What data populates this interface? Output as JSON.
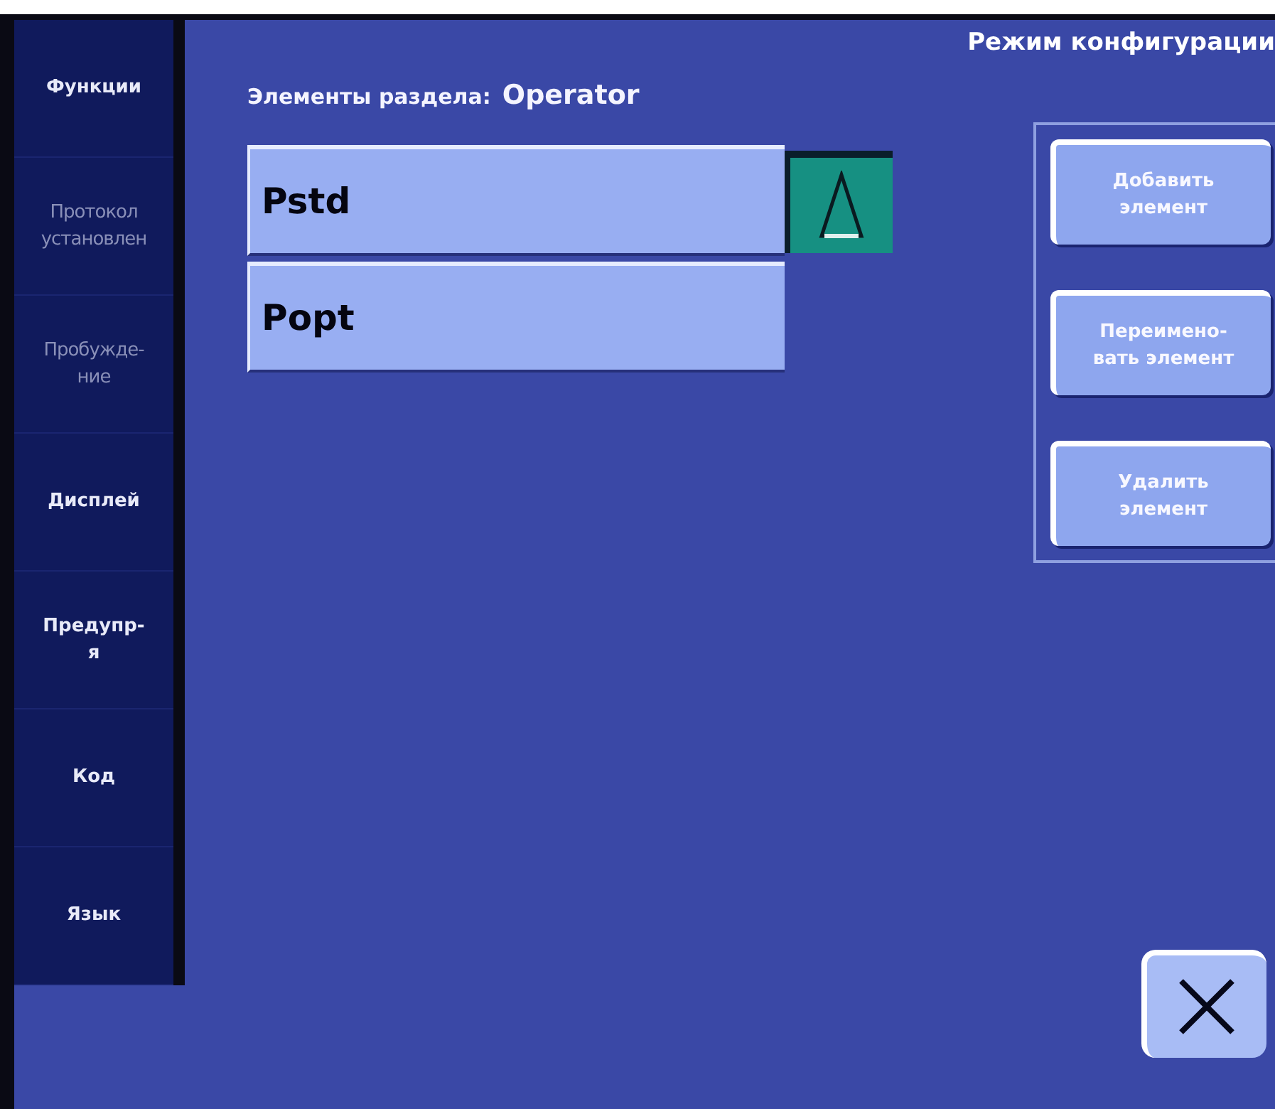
{
  "title": "Режим конфигурации",
  "sidebar": {
    "items": [
      {
        "label": "Функции",
        "disabled": false
      },
      {
        "label": "Протокол\nустановлен",
        "disabled": true
      },
      {
        "label": "Пробужде-\nние",
        "disabled": true
      },
      {
        "label": "Дисплей",
        "disabled": false
      },
      {
        "label": "Предупр-\nя",
        "disabled": false
      },
      {
        "label": "Код",
        "disabled": false
      },
      {
        "label": "Язык",
        "disabled": false
      }
    ]
  },
  "section": {
    "label": "Элементы раздела:",
    "name": "Operator"
  },
  "elements": [
    {
      "label": "Pstd"
    },
    {
      "label": "Popt"
    }
  ],
  "actions": [
    "Добавить\nэлемент",
    "Переимено-\nвать элемент",
    "Удалить\nэлемент"
  ]
}
